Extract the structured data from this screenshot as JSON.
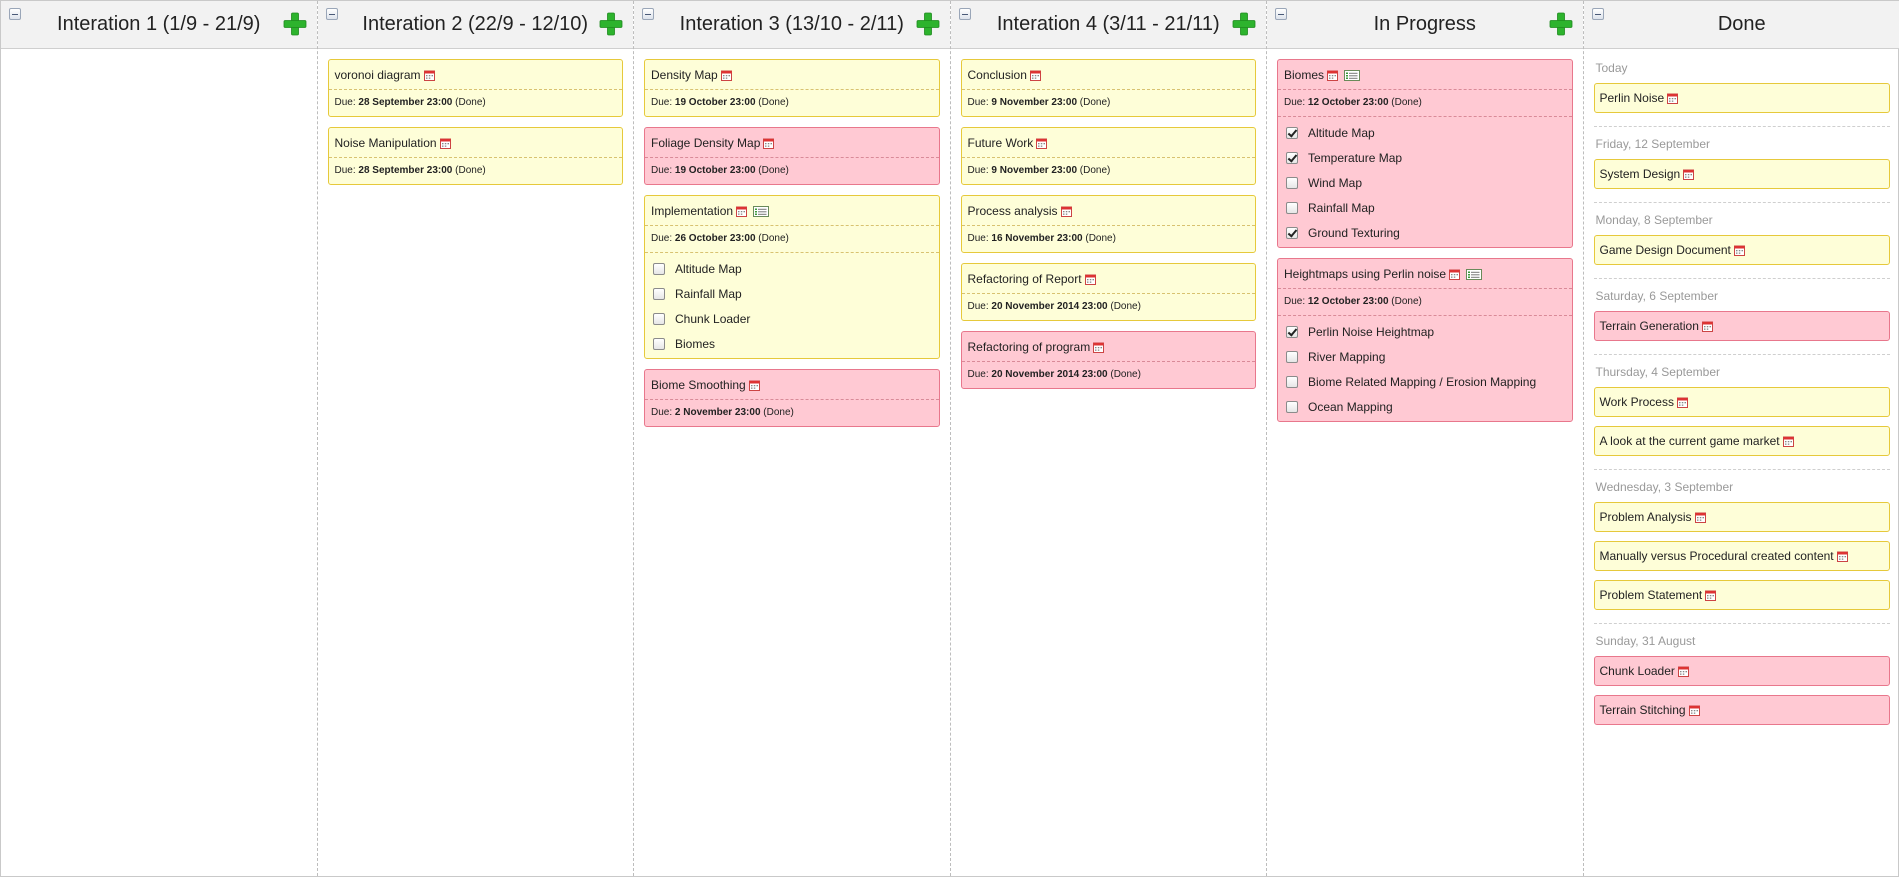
{
  "colors": {
    "yellow_card": "#fefed8",
    "pink_card": "#ffc9d3",
    "add_green": "#2db32d"
  },
  "columns": [
    {
      "title": "Interation 1 (1/9 - 21/9)",
      "cards": []
    },
    {
      "title": "Interation 2 (22/9 - 12/10)",
      "cards": [
        {
          "title": "voronoi diagram",
          "due_prefix": "Due:",
          "due": "28 September 23:00",
          "status": "(Done)",
          "color": "yellow"
        },
        {
          "title": "Noise Manipulation",
          "due_prefix": "Due:",
          "due": "28 September 23:00",
          "status": "(Done)",
          "color": "yellow"
        }
      ]
    },
    {
      "title": "Interation 3 (13/10 - 2/11)",
      "cards": [
        {
          "title": "Density Map",
          "due_prefix": "Due:",
          "due": "19 October 23:00",
          "status": "(Done)",
          "color": "yellow"
        },
        {
          "title": "Foliage Density Map",
          "due_prefix": "Due:",
          "due": "19 October 23:00",
          "status": "(Done)",
          "color": "pink"
        },
        {
          "title": "Implementation",
          "due_prefix": "Due:",
          "due": "26 October 23:00",
          "status": "(Done)",
          "color": "yellow",
          "has_checklist": true,
          "checklist": [
            {
              "label": "Altitude Map",
              "checked": false
            },
            {
              "label": "Rainfall Map",
              "checked": false
            },
            {
              "label": "Chunk Loader",
              "checked": false
            },
            {
              "label": "Biomes",
              "checked": false
            }
          ]
        },
        {
          "title": "Biome Smoothing",
          "due_prefix": "Due:",
          "due": "2 November 23:00",
          "status": "(Done)",
          "color": "pink"
        }
      ]
    },
    {
      "title": "Interation 4 (3/11 - 21/11)",
      "cards": [
        {
          "title": "Conclusion",
          "due_prefix": "Due:",
          "due": "9 November 23:00",
          "status": "(Done)",
          "color": "yellow"
        },
        {
          "title": "Future Work",
          "due_prefix": "Due:",
          "due": "9 November 23:00",
          "status": "(Done)",
          "color": "yellow"
        },
        {
          "title": "Process analysis",
          "due_prefix": "Due:",
          "due": "16 November 23:00",
          "status": "(Done)",
          "color": "yellow"
        },
        {
          "title": "Refactoring of Report",
          "due_prefix": "Due:",
          "due": "20 November 2014 23:00",
          "status": "(Done)",
          "color": "yellow"
        },
        {
          "title": "Refactoring of program",
          "due_prefix": "Due:",
          "due": "20 November 2014 23:00",
          "status": "(Done)",
          "color": "pink"
        }
      ]
    },
    {
      "title": "In Progress",
      "cards": [
        {
          "title": "Biomes",
          "due_prefix": "Due:",
          "due": "12 October 23:00",
          "status": "(Done)",
          "color": "pink",
          "has_checklist": true,
          "checklist": [
            {
              "label": "Altitude Map",
              "checked": true
            },
            {
              "label": "Temperature Map",
              "checked": true
            },
            {
              "label": "Wind Map",
              "checked": false
            },
            {
              "label": "Rainfall Map",
              "checked": false
            },
            {
              "label": "Ground Texturing",
              "checked": true
            }
          ]
        },
        {
          "title": "Heightmaps using Perlin noise",
          "due_prefix": "Due:",
          "due": "12 October 23:00",
          "status": "(Done)",
          "color": "pink",
          "has_checklist": true,
          "checklist": [
            {
              "label": "Perlin Noise Heightmap",
              "checked": true
            },
            {
              "label": "River Mapping",
              "checked": false
            },
            {
              "label": "Biome Related Mapping / Erosion Mapping",
              "checked": false
            },
            {
              "label": "Ocean Mapping",
              "checked": false
            }
          ]
        }
      ]
    }
  ],
  "done": {
    "title": "Done",
    "groups": [
      {
        "label": "Today",
        "cards": [
          {
            "title": "Perlin Noise",
            "color": "yellow"
          }
        ]
      },
      {
        "label": "Friday, 12 September",
        "cards": [
          {
            "title": "System Design",
            "color": "yellow"
          }
        ]
      },
      {
        "label": "Monday, 8 September",
        "cards": [
          {
            "title": "Game Design Document",
            "color": "yellow"
          }
        ]
      },
      {
        "label": "Saturday, 6 September",
        "cards": [
          {
            "title": "Terrain Generation",
            "color": "pink"
          }
        ]
      },
      {
        "label": "Thursday, 4 September",
        "cards": [
          {
            "title": "Work Process",
            "color": "yellow"
          },
          {
            "title": "A look at the current game market",
            "color": "yellow"
          }
        ]
      },
      {
        "label": "Wednesday, 3 September",
        "cards": [
          {
            "title": "Problem Analysis",
            "color": "yellow"
          },
          {
            "title": "Manually versus Procedural created content",
            "color": "yellow"
          },
          {
            "title": "Problem Statement",
            "color": "yellow"
          }
        ]
      },
      {
        "label": "Sunday, 31 August",
        "cards": [
          {
            "title": "Chunk Loader",
            "color": "pink"
          },
          {
            "title": "Terrain Stitching",
            "color": "pink"
          }
        ]
      }
    ]
  }
}
